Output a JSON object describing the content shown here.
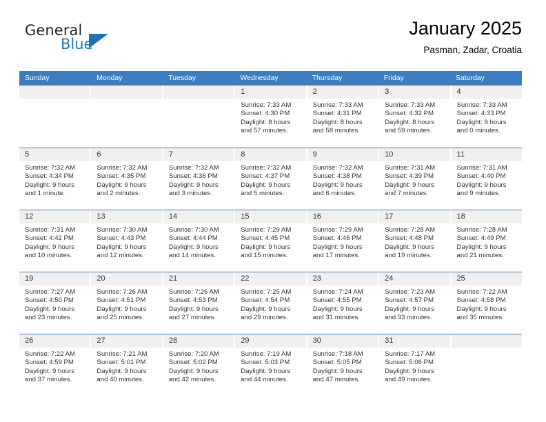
{
  "brand": {
    "word1": "General",
    "word2": "Blue",
    "triangle_color": "#1f72b6",
    "text_color": "#231f20",
    "blue_color": "#1c79c0"
  },
  "header": {
    "title": "January 2025",
    "subtitle": "Pasman, Zadar, Croatia"
  },
  "theme": {
    "header_band": "#3d7dbf",
    "daynum_band": "#f0f0f0",
    "text": "#333333"
  },
  "calendar": {
    "weekday_headers": [
      "Sunday",
      "Monday",
      "Tuesday",
      "Wednesday",
      "Thursday",
      "Friday",
      "Saturday"
    ],
    "weeks": [
      [
        {
          "day": "",
          "sunrise": "",
          "sunset": "",
          "daylight1": "",
          "daylight2": ""
        },
        {
          "day": "",
          "sunrise": "",
          "sunset": "",
          "daylight1": "",
          "daylight2": ""
        },
        {
          "day": "",
          "sunrise": "",
          "sunset": "",
          "daylight1": "",
          "daylight2": ""
        },
        {
          "day": "1",
          "sunrise": "Sunrise: 7:33 AM",
          "sunset": "Sunset: 4:30 PM",
          "daylight1": "Daylight: 8 hours",
          "daylight2": "and 57 minutes."
        },
        {
          "day": "2",
          "sunrise": "Sunrise: 7:33 AM",
          "sunset": "Sunset: 4:31 PM",
          "daylight1": "Daylight: 8 hours",
          "daylight2": "and 58 minutes."
        },
        {
          "day": "3",
          "sunrise": "Sunrise: 7:33 AM",
          "sunset": "Sunset: 4:32 PM",
          "daylight1": "Daylight: 8 hours",
          "daylight2": "and 59 minutes."
        },
        {
          "day": "4",
          "sunrise": "Sunrise: 7:33 AM",
          "sunset": "Sunset: 4:33 PM",
          "daylight1": "Daylight: 9 hours",
          "daylight2": "and 0 minutes."
        }
      ],
      [
        {
          "day": "5",
          "sunrise": "Sunrise: 7:32 AM",
          "sunset": "Sunset: 4:34 PM",
          "daylight1": "Daylight: 9 hours",
          "daylight2": "and 1 minute."
        },
        {
          "day": "6",
          "sunrise": "Sunrise: 7:32 AM",
          "sunset": "Sunset: 4:35 PM",
          "daylight1": "Daylight: 9 hours",
          "daylight2": "and 2 minutes."
        },
        {
          "day": "7",
          "sunrise": "Sunrise: 7:32 AM",
          "sunset": "Sunset: 4:36 PM",
          "daylight1": "Daylight: 9 hours",
          "daylight2": "and 3 minutes."
        },
        {
          "day": "8",
          "sunrise": "Sunrise: 7:32 AM",
          "sunset": "Sunset: 4:37 PM",
          "daylight1": "Daylight: 9 hours",
          "daylight2": "and 5 minutes."
        },
        {
          "day": "9",
          "sunrise": "Sunrise: 7:32 AM",
          "sunset": "Sunset: 4:38 PM",
          "daylight1": "Daylight: 9 hours",
          "daylight2": "and 6 minutes."
        },
        {
          "day": "10",
          "sunrise": "Sunrise: 7:31 AM",
          "sunset": "Sunset: 4:39 PM",
          "daylight1": "Daylight: 9 hours",
          "daylight2": "and 7 minutes."
        },
        {
          "day": "11",
          "sunrise": "Sunrise: 7:31 AM",
          "sunset": "Sunset: 4:40 PM",
          "daylight1": "Daylight: 9 hours",
          "daylight2": "and 9 minutes."
        }
      ],
      [
        {
          "day": "12",
          "sunrise": "Sunrise: 7:31 AM",
          "sunset": "Sunset: 4:42 PM",
          "daylight1": "Daylight: 9 hours",
          "daylight2": "and 10 minutes."
        },
        {
          "day": "13",
          "sunrise": "Sunrise: 7:30 AM",
          "sunset": "Sunset: 4:43 PM",
          "daylight1": "Daylight: 9 hours",
          "daylight2": "and 12 minutes."
        },
        {
          "day": "14",
          "sunrise": "Sunrise: 7:30 AM",
          "sunset": "Sunset: 4:44 PM",
          "daylight1": "Daylight: 9 hours",
          "daylight2": "and 14 minutes."
        },
        {
          "day": "15",
          "sunrise": "Sunrise: 7:29 AM",
          "sunset": "Sunset: 4:45 PM",
          "daylight1": "Daylight: 9 hours",
          "daylight2": "and 15 minutes."
        },
        {
          "day": "16",
          "sunrise": "Sunrise: 7:29 AM",
          "sunset": "Sunset: 4:46 PM",
          "daylight1": "Daylight: 9 hours",
          "daylight2": "and 17 minutes."
        },
        {
          "day": "17",
          "sunrise": "Sunrise: 7:28 AM",
          "sunset": "Sunset: 4:48 PM",
          "daylight1": "Daylight: 9 hours",
          "daylight2": "and 19 minutes."
        },
        {
          "day": "18",
          "sunrise": "Sunrise: 7:28 AM",
          "sunset": "Sunset: 4:49 PM",
          "daylight1": "Daylight: 9 hours",
          "daylight2": "and 21 minutes."
        }
      ],
      [
        {
          "day": "19",
          "sunrise": "Sunrise: 7:27 AM",
          "sunset": "Sunset: 4:50 PM",
          "daylight1": "Daylight: 9 hours",
          "daylight2": "and 23 minutes."
        },
        {
          "day": "20",
          "sunrise": "Sunrise: 7:26 AM",
          "sunset": "Sunset: 4:51 PM",
          "daylight1": "Daylight: 9 hours",
          "daylight2": "and 25 minutes."
        },
        {
          "day": "21",
          "sunrise": "Sunrise: 7:26 AM",
          "sunset": "Sunset: 4:53 PM",
          "daylight1": "Daylight: 9 hours",
          "daylight2": "and 27 minutes."
        },
        {
          "day": "22",
          "sunrise": "Sunrise: 7:25 AM",
          "sunset": "Sunset: 4:54 PM",
          "daylight1": "Daylight: 9 hours",
          "daylight2": "and 29 minutes."
        },
        {
          "day": "23",
          "sunrise": "Sunrise: 7:24 AM",
          "sunset": "Sunset: 4:55 PM",
          "daylight1": "Daylight: 9 hours",
          "daylight2": "and 31 minutes."
        },
        {
          "day": "24",
          "sunrise": "Sunrise: 7:23 AM",
          "sunset": "Sunset: 4:57 PM",
          "daylight1": "Daylight: 9 hours",
          "daylight2": "and 33 minutes."
        },
        {
          "day": "25",
          "sunrise": "Sunrise: 7:22 AM",
          "sunset": "Sunset: 4:58 PM",
          "daylight1": "Daylight: 9 hours",
          "daylight2": "and 35 minutes."
        }
      ],
      [
        {
          "day": "26",
          "sunrise": "Sunrise: 7:22 AM",
          "sunset": "Sunset: 4:59 PM",
          "daylight1": "Daylight: 9 hours",
          "daylight2": "and 37 minutes."
        },
        {
          "day": "27",
          "sunrise": "Sunrise: 7:21 AM",
          "sunset": "Sunset: 5:01 PM",
          "daylight1": "Daylight: 9 hours",
          "daylight2": "and 40 minutes."
        },
        {
          "day": "28",
          "sunrise": "Sunrise: 7:20 AM",
          "sunset": "Sunset: 5:02 PM",
          "daylight1": "Daylight: 9 hours",
          "daylight2": "and 42 minutes."
        },
        {
          "day": "29",
          "sunrise": "Sunrise: 7:19 AM",
          "sunset": "Sunset: 5:03 PM",
          "daylight1": "Daylight: 9 hours",
          "daylight2": "and 44 minutes."
        },
        {
          "day": "30",
          "sunrise": "Sunrise: 7:18 AM",
          "sunset": "Sunset: 5:05 PM",
          "daylight1": "Daylight: 9 hours",
          "daylight2": "and 47 minutes."
        },
        {
          "day": "31",
          "sunrise": "Sunrise: 7:17 AM",
          "sunset": "Sunset: 5:06 PM",
          "daylight1": "Daylight: 9 hours",
          "daylight2": "and 49 minutes."
        },
        {
          "day": "",
          "sunrise": "",
          "sunset": "",
          "daylight1": "",
          "daylight2": ""
        }
      ]
    ]
  }
}
